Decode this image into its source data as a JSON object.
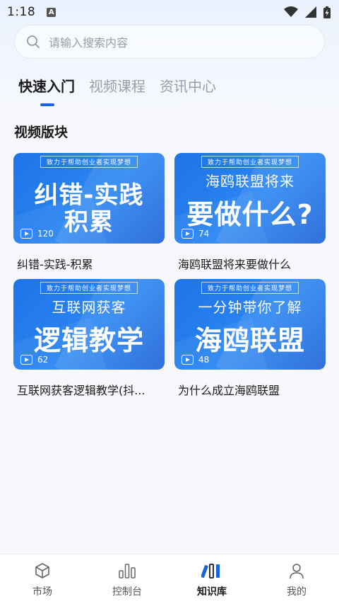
{
  "status_bar": {
    "time": "1:18",
    "notif_letter": "A"
  },
  "search": {
    "placeholder": "请输入搜索内容"
  },
  "tabs": [
    {
      "label": "快速入门",
      "active": true
    },
    {
      "label": "视频课程",
      "active": false
    },
    {
      "label": "资讯中心",
      "active": false
    }
  ],
  "section": {
    "title": "视频版块"
  },
  "videos": [
    {
      "banner": "致力于帮助创业者实现梦想",
      "subline": "",
      "headline_1": "纠错-实践",
      "headline_2": "积累",
      "views": "120",
      "title": "纠错-实践-积累"
    },
    {
      "banner": "致力于帮助创业者实现梦想",
      "subline": "海鸥联盟将来",
      "headline_1": "要做什么?",
      "headline_2": "",
      "views": "74",
      "title": "海鸥联盟将来要做什么"
    },
    {
      "banner": "致力于帮助创业者实现梦想",
      "subline": "互联网获客",
      "headline_1": "逻辑教学",
      "headline_2": "",
      "views": "62",
      "title": "互联网获客逻辑教学(抖..."
    },
    {
      "banner": "致力于帮助创业者实现梦想",
      "subline": "一分钟带你了解",
      "headline_1": "海鸥联盟",
      "headline_2": "",
      "views": "48",
      "title": "为什么成立海鸥联盟"
    }
  ],
  "bottom_nav": [
    {
      "label": "市场",
      "icon": "cube-icon",
      "active": false
    },
    {
      "label": "控制台",
      "icon": "bar-chart-icon",
      "active": false
    },
    {
      "label": "知识库",
      "icon": "books-icon",
      "active": true
    },
    {
      "label": "我的",
      "icon": "person-icon",
      "active": false
    }
  ],
  "colors": {
    "accent": "#1565d8",
    "thumb_blue": "#1f73e6"
  }
}
